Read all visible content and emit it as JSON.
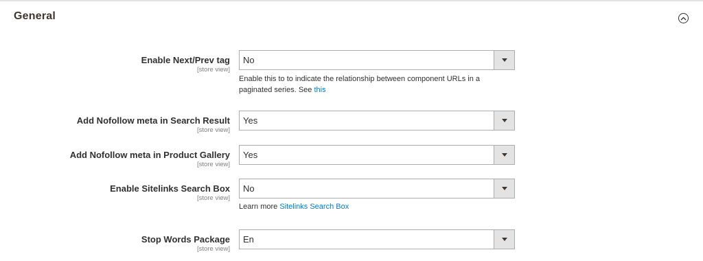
{
  "section": {
    "title": "General"
  },
  "rows": [
    {
      "label": "Enable Next/Prev tag",
      "scope": "[store view]",
      "value": "No",
      "note": "Enable this to to indicate the relationship between component URLs in a paginated series. See ",
      "note_link": "this"
    },
    {
      "label": "Add Nofollow meta in Search Result",
      "scope": "[store view]",
      "value": "Yes"
    },
    {
      "label": "Add Nofollow meta in Product Gallery",
      "scope": "[store view]",
      "value": "Yes"
    },
    {
      "label": "Enable Sitelinks Search Box",
      "scope": "[store view]",
      "value": "No",
      "note": "Learn more ",
      "note_link": "Sitelinks Search Box"
    },
    {
      "label": "Stop Words Package",
      "scope": "[store view]",
      "value": "En"
    }
  ],
  "icons": {
    "collapse": "chevron-up-circle-icon",
    "dropdown": "caret-down-icon"
  },
  "colors": {
    "link": "#007bdb",
    "select_border": "#adadad",
    "arrow_bg": "#e3e3e3"
  }
}
